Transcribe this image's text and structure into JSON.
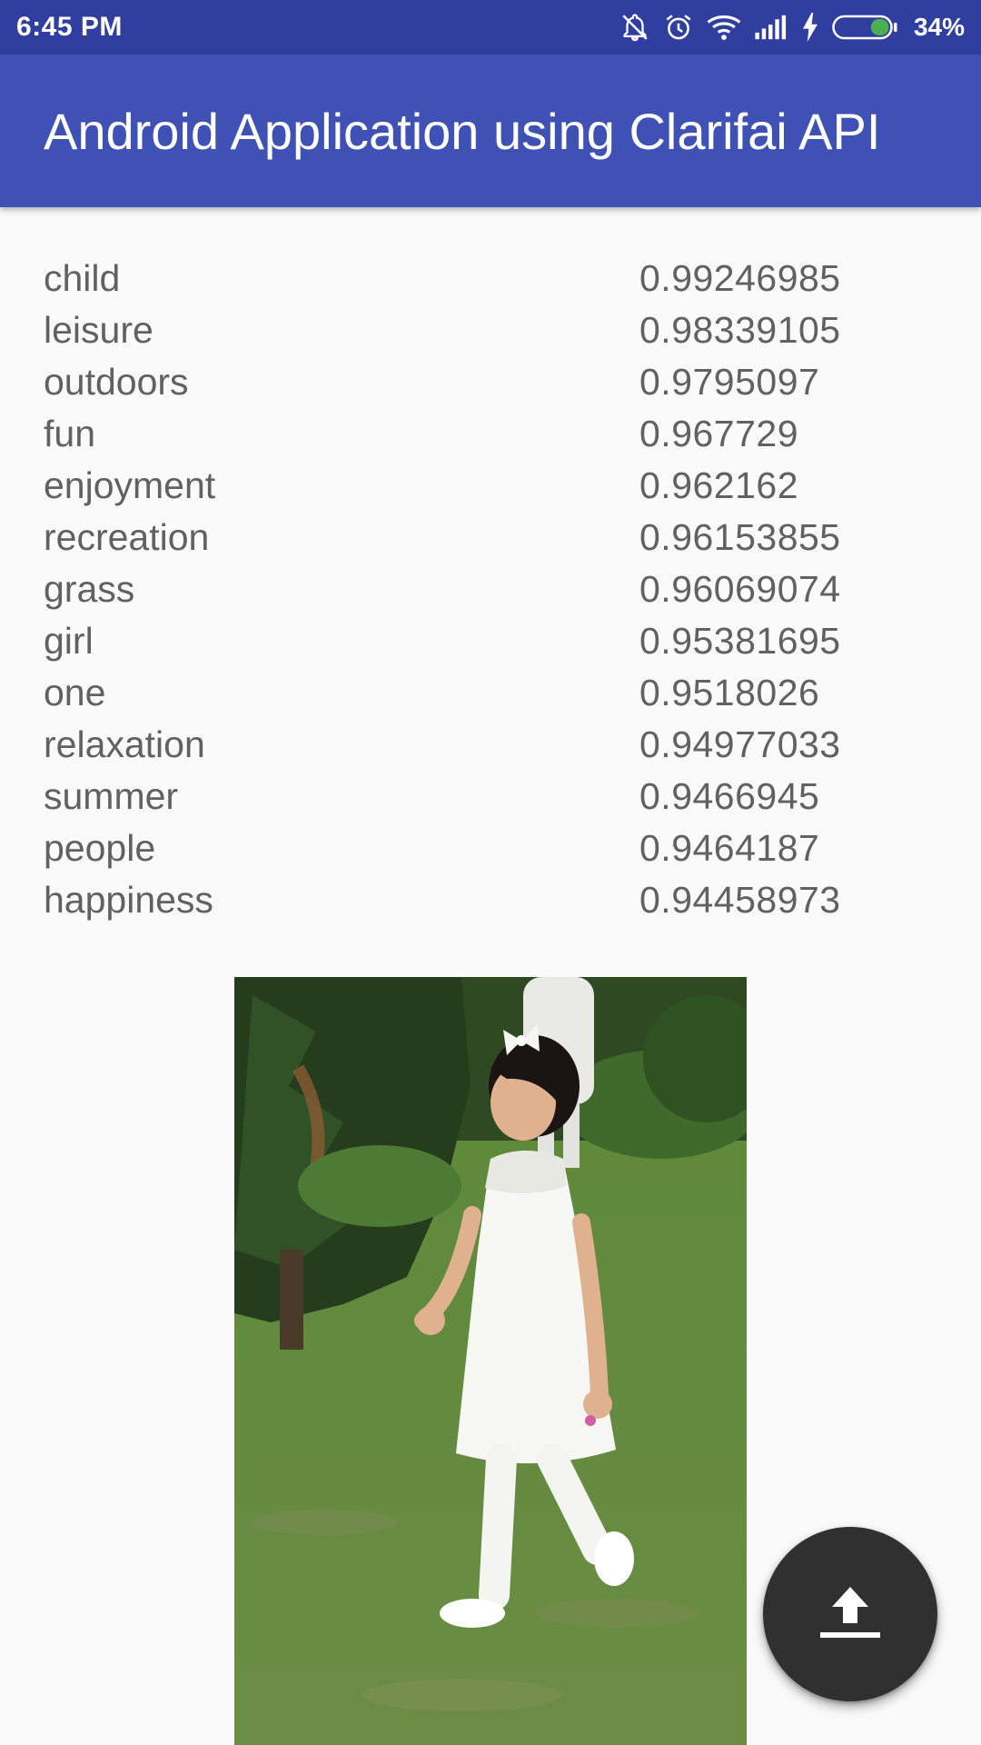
{
  "status_bar": {
    "time": "6:45 PM",
    "battery_percent": "34%",
    "battery_level": 0.34,
    "icons": [
      "notifications-off-icon",
      "alarm-icon",
      "wifi-icon",
      "signal-icon",
      "charging-icon",
      "battery-icon"
    ]
  },
  "app_bar": {
    "title": "Android Application using Clarifai API"
  },
  "results": [
    {
      "label": "child",
      "score": "0.99246985"
    },
    {
      "label": "leisure",
      "score": "0.98339105"
    },
    {
      "label": "outdoors",
      "score": "0.9795097"
    },
    {
      "label": "fun",
      "score": "0.967729"
    },
    {
      "label": "enjoyment",
      "score": "0.962162"
    },
    {
      "label": "recreation",
      "score": "0.96153855"
    },
    {
      "label": "grass",
      "score": "0.96069074"
    },
    {
      "label": "girl",
      "score": "0.95381695"
    },
    {
      "label": "one",
      "score": "0.9518026"
    },
    {
      "label": "relaxation",
      "score": "0.94977033"
    },
    {
      "label": "summer",
      "score": "0.9466945"
    },
    {
      "label": "people",
      "score": "0.9464187"
    },
    {
      "label": "happiness",
      "score": "0.94458973"
    }
  ],
  "fab": {
    "icon": "upload-icon"
  },
  "colors": {
    "status_bar": "#303f9f",
    "app_bar": "#3f51b5",
    "fab": "#303030",
    "battery_fill": "#4caf50"
  }
}
